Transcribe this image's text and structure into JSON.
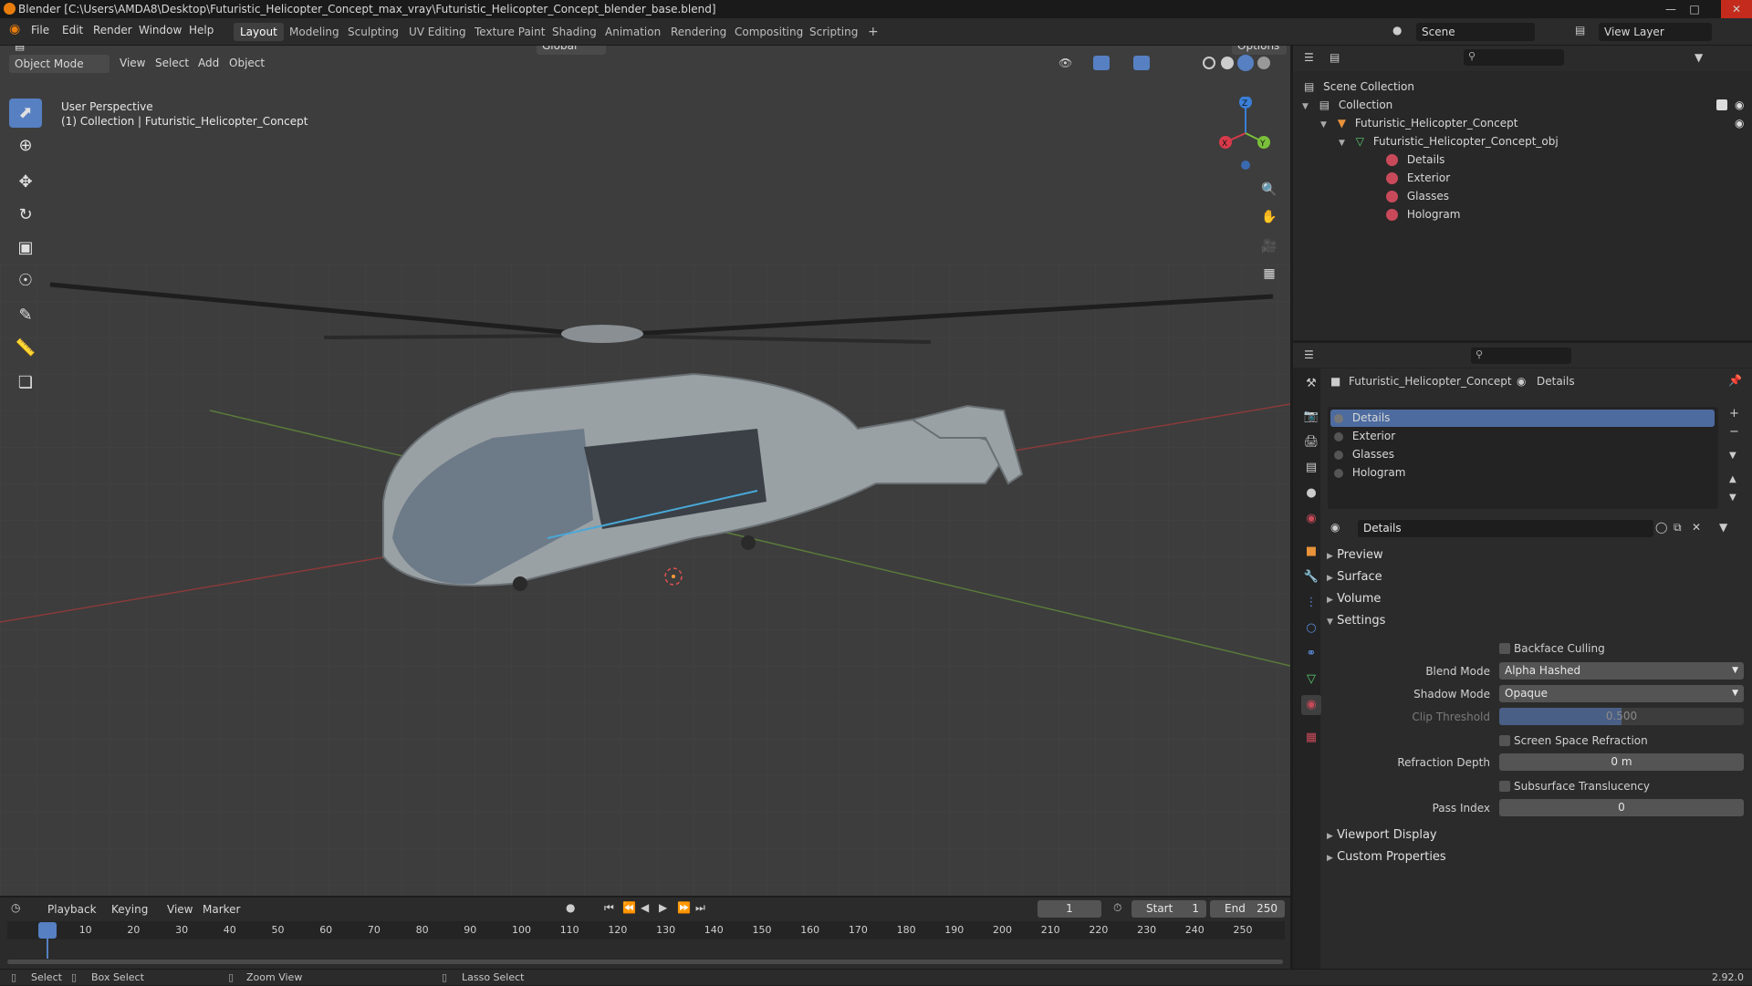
{
  "title": "Blender [C:\\Users\\AMDA8\\Desktop\\Futuristic_Helicopter_Concept_max_vray\\Futuristic_Helicopter_Concept_blender_base.blend]",
  "menu": [
    "File",
    "Edit",
    "Render",
    "Window",
    "Help"
  ],
  "workspaces": [
    "Layout",
    "Modeling",
    "Sculpting",
    "UV Editing",
    "Texture Paint",
    "Shading",
    "Animation",
    "Rendering",
    "Compositing",
    "Scripting"
  ],
  "add_workspace": "+",
  "scene": {
    "label": "Scene",
    "view_layer": "View Layer"
  },
  "viewport": {
    "mode": "Object Mode",
    "menus": [
      "View",
      "Select",
      "Add",
      "Object"
    ],
    "transform": "Global",
    "options": "Options",
    "perspective": "User Perspective",
    "collection_info": "(1) Collection | Futuristic_Helicopter_Concept",
    "gizmo": {
      "x": "X",
      "y": "Y",
      "z": "Z"
    }
  },
  "outliner": {
    "root": "Scene Collection",
    "collection": "Collection",
    "object": "Futuristic_Helicopter_Concept",
    "mesh": "Futuristic_Helicopter_Concept_obj",
    "materials": [
      "Details",
      "Exterior",
      "Glasses",
      "Hologram"
    ]
  },
  "properties": {
    "breadcrumb_object": "Futuristic_Helicopter_Concept",
    "breadcrumb_material": "Details",
    "slots": [
      "Details",
      "Exterior",
      "Glasses",
      "Hologram"
    ],
    "selected_slot": "Details",
    "material_name": "Details",
    "sections": {
      "preview": "Preview",
      "surface": "Surface",
      "volume": "Volume",
      "settings": "Settings",
      "viewport_display": "Viewport Display",
      "custom_properties": "Custom Properties"
    },
    "settings": {
      "backface_culling": "Backface Culling",
      "blend_mode_label": "Blend Mode",
      "blend_mode": "Alpha Hashed",
      "shadow_mode_label": "Shadow Mode",
      "shadow_mode": "Opaque",
      "clip_threshold_label": "Clip Threshold",
      "clip_threshold": "0.500",
      "ssr": "Screen Space Refraction",
      "refraction_depth_label": "Refraction Depth",
      "refraction_depth": "0 m",
      "subsurface": "Subsurface Translucency",
      "pass_index_label": "Pass Index",
      "pass_index": "0"
    }
  },
  "timeline": {
    "menus": [
      "Playback",
      "Keying",
      "View",
      "Marker"
    ],
    "current_frame": "1",
    "start_label": "Start",
    "start": "1",
    "end_label": "End",
    "end": "250",
    "ticks": [
      "1",
      "10",
      "20",
      "30",
      "40",
      "50",
      "60",
      "70",
      "80",
      "90",
      "100",
      "110",
      "120",
      "130",
      "140",
      "150",
      "160",
      "170",
      "180",
      "190",
      "200",
      "210",
      "220",
      "230",
      "240",
      "250"
    ]
  },
  "status": {
    "select": "Select",
    "box_select": "Box Select",
    "zoom_view": "Zoom View",
    "lasso_select": "Lasso Select",
    "version": "2.92.0"
  },
  "colors": {
    "accent": "#5680c2",
    "selection": "#4d6b9e",
    "material_icon": "#c84a5a",
    "object_icon": "#e8923a",
    "mesh_icon": "#5ad073"
  }
}
